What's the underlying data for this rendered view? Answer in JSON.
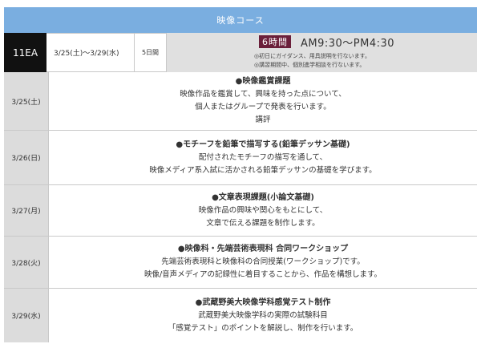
{
  "course_header": "映像コース",
  "summary": {
    "code": "11EA",
    "dates": "3/25(土)〜3/29(水)",
    "days": "5日間",
    "hours": "6時間",
    "time_range": "AM9:30〜PM4:30",
    "notes": [
      "◎初日にガイダンス、用具説明を行ないます。",
      "◎講習期間中、個別進学相談を行ないます。"
    ]
  },
  "schedule": [
    {
      "date": "3/25(土)",
      "title": "●映像鑑賞課題",
      "lines": [
        "映像作品を鑑賞して、興味を持った点について、",
        "個人またはグループで発表を行います。",
        "講評"
      ]
    },
    {
      "date": "3/26(日)",
      "title": "●モチーフを鉛筆で描写する(鉛筆デッサン基礎)",
      "lines": [
        "配付されたモチーフの描写を通して、",
        "映像メディア系入試に活かされる鉛筆デッサンの基礎を学びます。"
      ]
    },
    {
      "date": "3/27(月)",
      "title": "●文章表現課題(小論文基礎)",
      "lines": [
        "映像作品の興味や関心をもとにして、",
        "文章で伝える課題を制作します。"
      ]
    },
    {
      "date": "3/28(火)",
      "title": "●映像科・先端芸術表現科 合同ワークショップ",
      "lines": [
        "先端芸術表現科と映像科の合同授業(ワークショップ)です。",
        "映像/音声メディアの記録性に着目することから、作品を構想します。"
      ]
    },
    {
      "date": "3/29(水)",
      "title": "●武蔵野美大映像学科感覚テスト制作",
      "lines": [
        "武蔵野美大映像学科の実際の試験科目",
        "「感覚テスト」のポイントを解説し、制作を行います。"
      ]
    }
  ]
}
